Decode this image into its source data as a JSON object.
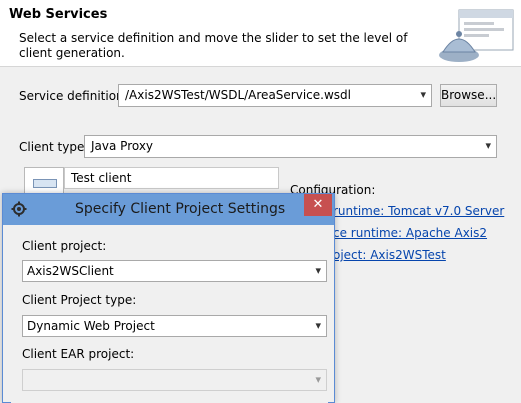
{
  "header": {
    "title": "Web Services",
    "description": "Select a service definition and move the slider to set the level of client generation."
  },
  "service_definition": {
    "label": "Service definition:",
    "value": "/Axis2WSTest/WSDL/AreaService.wsdl",
    "browse_label": "Browse..."
  },
  "client_type": {
    "label": "Client type:",
    "value": "Java Proxy"
  },
  "slider": {
    "level_label": "Test client"
  },
  "configuration": {
    "label": "Configuration:",
    "server_runtime": "runtime: Tomcat v7.0 Server",
    "ws_runtime": "ce runtime: Apache Axis2",
    "client_project": "oject: Axis2WSTest"
  },
  "dialog": {
    "title": "Specify Client Project Settings",
    "close_glyph": "✕",
    "client_project_label": "Client project:",
    "client_project_value": "Axis2WSClient",
    "client_project_type_label": "Client Project type:",
    "client_project_type_value": "Dynamic Web Project",
    "client_ear_label": "Client EAR project:",
    "client_ear_value": ""
  }
}
